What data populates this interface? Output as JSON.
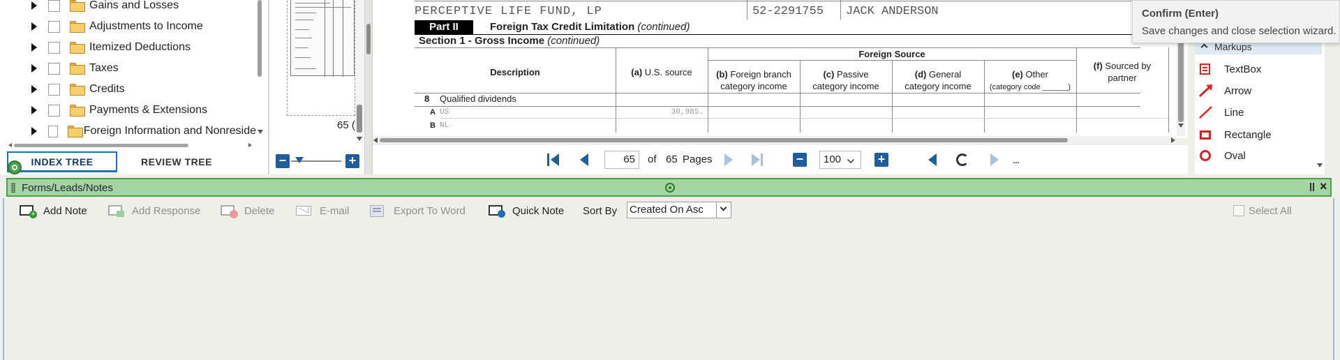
{
  "tree": {
    "items": [
      {
        "label": "Gains and Losses"
      },
      {
        "label": "Adjustments to Income"
      },
      {
        "label": "Itemized Deductions"
      },
      {
        "label": "Taxes"
      },
      {
        "label": "Credits"
      },
      {
        "label": "Payments & Extensions"
      },
      {
        "label": "Foreign Information and Nonreside"
      }
    ],
    "tabs": {
      "index": "INDEX TREE",
      "review": "REVIEW TREE"
    }
  },
  "thumbnail": {
    "page_label": "65 ("
  },
  "document": {
    "partnership_name": "PERCEPTIVE LIFE FUND, LP",
    "ein": "52-2291755",
    "partner_name": "JACK ANDERSON",
    "part_label": "Part II",
    "part_title": "Foreign Tax Credit Limitation",
    "part_title_cont": "(continued)",
    "section_title": "Section 1 - Gross Income",
    "section_cont": "(continued)",
    "foreign_source_header": "Foreign Source",
    "columns": {
      "description": "Description",
      "a_prefix": "(a)",
      "a": "U.S. source",
      "b_prefix": "(b)",
      "b1": "Foreign branch",
      "b2": "category income",
      "c_prefix": "(c)",
      "c1": "Passive",
      "c2": "category income",
      "d_prefix": "(d)",
      "d1": "General",
      "d2": "category income",
      "e_prefix": "(e)",
      "e1": "Other",
      "e2": "(category code ______)",
      "f_prefix": "(f)",
      "f1": "Sourced by",
      "f2": "partner"
    },
    "line8_num": "8",
    "line8_label": "Qualified dividends",
    "row_a_letter": "A",
    "row_a_code": "US",
    "row_a_amount": "30,985.",
    "row_b_letter": "B",
    "row_b_code": "NL"
  },
  "pager": {
    "current_page": "65",
    "of": "of",
    "total_pages": "65",
    "pages_label": "Pages",
    "zoom": "100"
  },
  "markups": {
    "header": "Markups",
    "items": [
      {
        "label": "TextBox"
      },
      {
        "label": "Arrow"
      },
      {
        "label": "Line"
      },
      {
        "label": "Rectangle"
      },
      {
        "label": "Oval"
      }
    ]
  },
  "tooltip": {
    "title": "Confirm (Enter)",
    "description": "Save changes and close selection wizard."
  },
  "lower_panel": {
    "title": "Forms/Leads/Notes",
    "toolbar": {
      "add_note": "Add Note",
      "add_response": "Add Response",
      "delete": "Delete",
      "email": "E-mail",
      "export_word": "Export To Word",
      "quick_note": "Quick Note",
      "sort_by": "Sort By",
      "sort_value": "Created On Asc",
      "select_all": "Select All"
    }
  },
  "colors": {
    "accent_blue": "#1f5d9c",
    "panel_green": "#a5d4a3",
    "markup_red": "#e02020"
  }
}
